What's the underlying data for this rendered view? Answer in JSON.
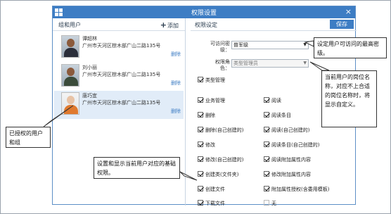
{
  "dialog": {
    "title": "权限设置",
    "close": "×"
  },
  "left": {
    "tab": "组和用户",
    "add": "添加",
    "users": [
      {
        "name": "谭超林",
        "address": "广州市天河区棕木部广山二路135号",
        "delete": "删除"
      },
      {
        "name": "刘小丽",
        "address": "广州市天河区棕木部广山二路135号",
        "delete": "删除"
      },
      {
        "name": "唐巧宜",
        "address": "广州市天河区棕木部广山二路135号",
        "delete": "删除"
      }
    ]
  },
  "right": {
    "tab": "权限设定",
    "save": "保存",
    "access_level_label_1": "可访问密",
    "access_level_label_2": "级：",
    "access_level_value": "普军级",
    "role_label_1": "权限角",
    "role_label_2": "色：",
    "role_value": "类型管理员",
    "permissions": [
      {
        "label": "类型管理",
        "checked": true
      },
      {
        "label": "业务管理",
        "checked": true
      },
      {
        "label": "阅读",
        "checked": true
      },
      {
        "label": "删除",
        "checked": true
      },
      {
        "label": "阅读条目",
        "checked": true
      },
      {
        "label": "删除(自己创建的)",
        "checked": true
      },
      {
        "label": "阅读(自己创建的)",
        "checked": true
      },
      {
        "label": "修改",
        "checked": true
      },
      {
        "label": "阅读条目(自己创建的)",
        "checked": true
      },
      {
        "label": "修改(自己创建的)",
        "checked": true
      },
      {
        "label": "阅读附加属性内容",
        "checked": true
      },
      {
        "label": "创建类(文件夹)",
        "checked": true
      },
      {
        "label": "修改附加属性内容",
        "checked": true
      },
      {
        "label": "创建文件",
        "checked": true
      },
      {
        "label": "附加属性授权(含委用模板)",
        "checked": true
      },
      {
        "label": "下载文件",
        "checked": true
      },
      {
        "label": "无",
        "checked": false
      }
    ]
  },
  "callouts": {
    "access": "设定用户可访问的最高密级。",
    "role": "当前用户的岗位名称，对应不上合适的岗位名称时，将显示自定义。",
    "users": "已授权的用户和组",
    "permissions": "设置和显示当前用户对应的基础权限。"
  }
}
